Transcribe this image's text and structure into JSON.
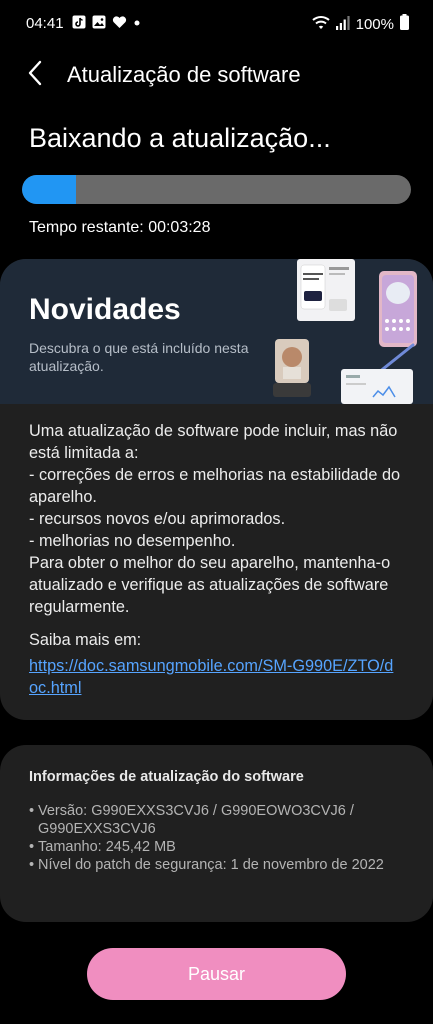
{
  "status_bar": {
    "time": "04:41",
    "battery": "100%",
    "left_icons": [
      "tiktok-icon",
      "image-icon",
      "heart-icon",
      "dot-icon"
    ],
    "right_icons": [
      "wifi-icon",
      "signal-icon",
      "battery-icon"
    ]
  },
  "app_bar": {
    "title": "Atualização de software",
    "back_icon": "back-arrow-icon"
  },
  "download": {
    "heading": "Baixando a atualização...",
    "progress_fraction": 0.14,
    "time_label": "Tempo restante:",
    "time_value": "00:03:28",
    "colors": {
      "fill": "#2196f3",
      "track": "#6a6a6a"
    }
  },
  "whats_new": {
    "title": "Novidades",
    "description": "Descubra o que está incluído nesta atualização.",
    "body_lines": [
      "Uma atualização de software pode incluir, mas não está limitada a:",
      " - correções de erros e melhorias na estabilidade do aparelho.",
      " - recursos novos e/ou aprimorados.",
      " - melhorias no desempenho.",
      "Para obter o melhor do seu aparelho, mantenha-o atualizado e verifique as atualizações de software regularmente."
    ],
    "learn_more_label": "Saiba mais em:",
    "learn_more_link": "https://doc.samsungmobile.com/SM-G990E/ZTO/doc.html"
  },
  "software_info": {
    "title": "Informações de atualização do software",
    "items": [
      "Versão: G990EXXS3CVJ6 / G990EOWO3CVJ6 / G990EXXS3CVJ6",
      "Tamanho: 245,42 MB",
      "Nível do patch de segurança: 1 de novembro de 2022"
    ]
  },
  "actions": {
    "pause_label": "Pausar",
    "pause_color": "#f08ec0"
  }
}
